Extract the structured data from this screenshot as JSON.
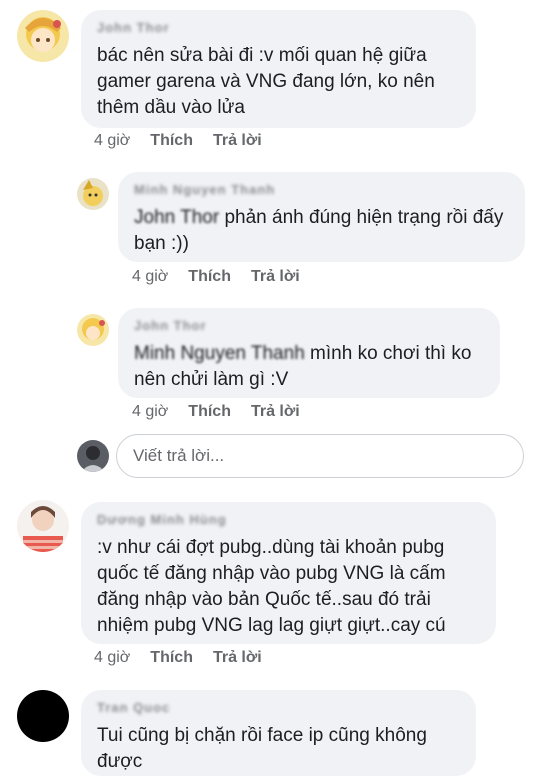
{
  "comments": [
    {
      "author": "John Thor",
      "text": "bác nên sửa bài đi :v mối quan hệ giữa gamer garena và VNG đang lớn, ko nên thêm dầu vào lửa",
      "time": "4 giờ",
      "like": "Thích",
      "reply": "Trả lời"
    },
    {
      "author": "Minh Nguyen Thanh",
      "mention": "John Thor",
      "text": "phản ánh đúng hiện trạng rồi đấy bạn :))",
      "time": "4 giờ",
      "like": "Thích",
      "reply": "Trả lời"
    },
    {
      "author": "John Thor",
      "mention": "Minh Nguyen Thanh",
      "text": "mình ko chơi thì ko nên chửi làm gì :V",
      "time": "4 giờ",
      "like": "Thích",
      "reply": "Trả lời"
    },
    {
      "author": "Dương Minh Hùng",
      "text": ":v như cái đợt pubg..dùng tài khoản pubg quốc tế đăng nhập vào pubg VNG là cấm đăng nhập vào bản Quốc tế..sau đó trải nhiệm pubg VNG lag lag giựt giựt..cay cú",
      "time": "4 giờ",
      "like": "Thích",
      "reply": "Trả lời"
    },
    {
      "author": "Tran Quoc",
      "text": "Tui cũng bị chặn rồi face ip cũng không được"
    }
  ],
  "reply_box": {
    "placeholder": "Viết trả lời..."
  },
  "colors": {
    "bubble": "#f0f2f5",
    "action_text": "#65676b",
    "text": "#1c1e21"
  }
}
